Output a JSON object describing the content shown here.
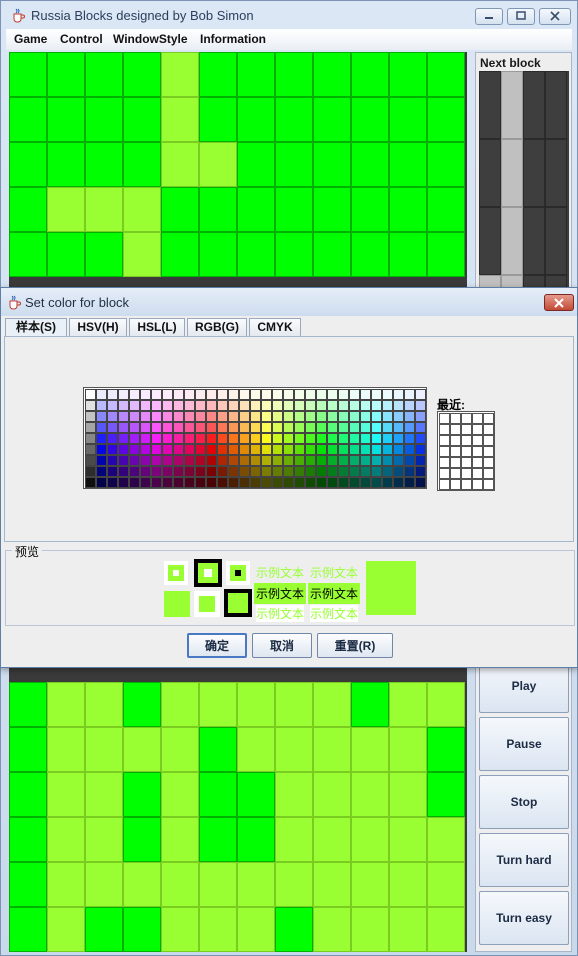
{
  "window": {
    "title": "Russia Blocks designed by Bob Simon"
  },
  "menu": [
    "Game",
    "Control",
    "WindowStyle",
    "Information"
  ],
  "side": {
    "next_label": "Next block",
    "next_grid": [
      "DLDD",
      "DLDD",
      "DLDD",
      "LLDD"
    ],
    "buttons": [
      "Play",
      "Pause",
      "Stop",
      "Turn hard",
      "Turn easy"
    ]
  },
  "board": {
    "top_rows": [
      "GGGGYGGGGGGG",
      "GGGGYGGGGGGG",
      "GGGGYYGGGGGG",
      "GYYYGGGGGGGG",
      "GGGYGGGGGGGG"
    ],
    "bottom_rows": [
      "GYYGYYYYYGYY",
      "GYYYYGYYYYYG",
      "GYYGYGGYYYYG",
      "GYYGYGGYYYYY",
      "GYYYYYYYYYYY",
      "GYGGYYYGYYYY"
    ]
  },
  "dialog": {
    "title": "Set color for block",
    "tabs": [
      "样本(S)",
      "HSV(H)",
      "HSL(L)",
      "RGB(G)",
      "CMYK"
    ],
    "recent_label": "最近:",
    "preview_label": "预览",
    "sample_text": "示例文本",
    "buttons": {
      "ok": "确定",
      "cancel": "取消",
      "reset": "重置(R)"
    }
  },
  "colors": {
    "selected": "#99ff33",
    "block_green": "#00ff00"
  }
}
